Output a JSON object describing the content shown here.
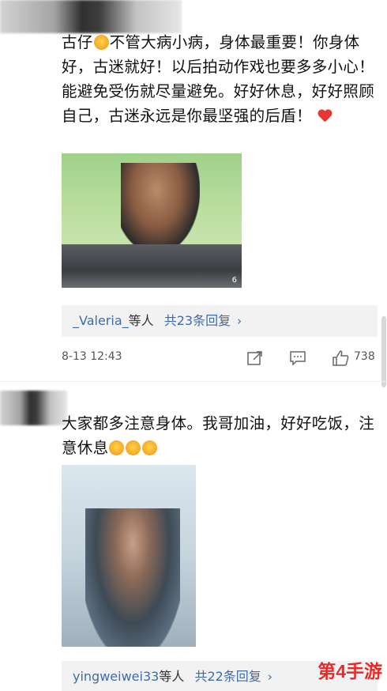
{
  "comment1": {
    "text_before_emoji": "古仔",
    "text_after_emoji": "不管大病小病，身体最重要！你身体好，古迷就好！以后拍动作戏也要多多小心！能避免受伤就尽量避免。好好休息，好好照顾自己，古迷永远是你最坚强的后盾！",
    "photo_watermark": "6",
    "reply_user": "_Valeria_",
    "reply_suffix": "等人",
    "reply_count": "共23条回复",
    "time": "8-13 12:43",
    "like_count": "738"
  },
  "comment2": {
    "text": "大家都多注意身体。我哥加油，好好吃饭，注意休息",
    "reply_user": "yingweiwei33",
    "reply_suffix": "等人",
    "reply_count": "共22条回复"
  },
  "site_watermark": "第4手游",
  "icons": {
    "share": "share-icon",
    "comment": "comment-icon",
    "like": "thumbs-up-icon",
    "arrow": "chevron-right-icon"
  },
  "colors": {
    "link": "#3d6ca8",
    "heart": "#e53935",
    "watermark": "#e82a2a"
  }
}
